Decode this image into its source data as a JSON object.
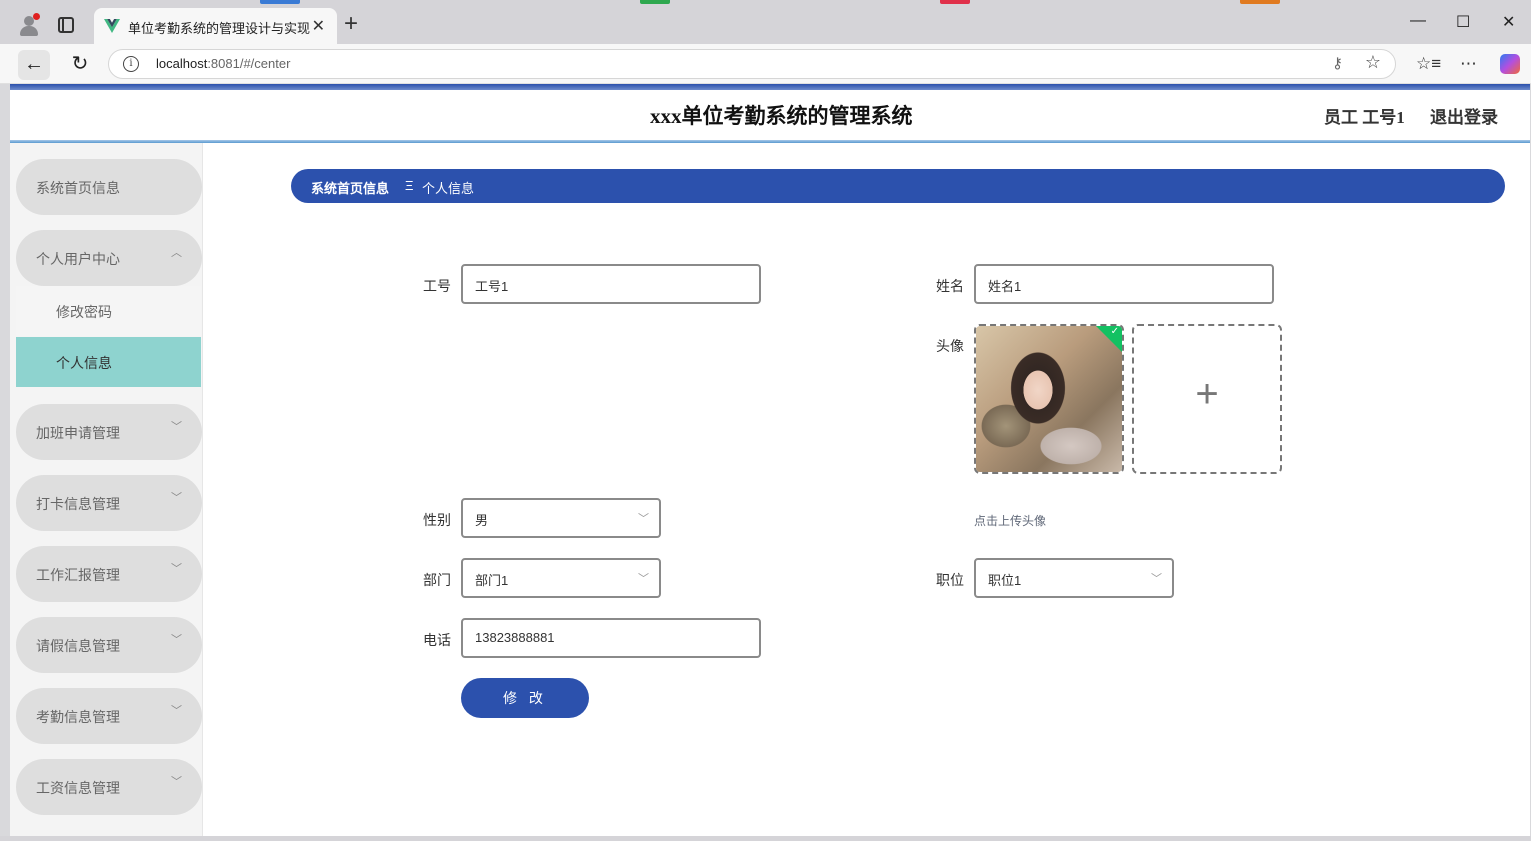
{
  "browser": {
    "tab_title": "单位考勤系统的管理设计与实现",
    "tab_close": "✕",
    "new_tab": "+",
    "url_host": "localhost",
    "url_rest": ":8081/#/center",
    "window_controls": {
      "minimize": "—",
      "maximize": "☐",
      "close": "✕"
    }
  },
  "header": {
    "system_name": "xxx单位考勤系统的管理系统",
    "user": "员工 工号1",
    "logout": "退出登录"
  },
  "sidebar": {
    "home": "系统首页信息",
    "personal_center": "个人用户中心",
    "sub_items": [
      "修改密码",
      "个人信息"
    ],
    "groups": [
      "加班申请管理",
      "打卡信息管理",
      "工作汇报管理",
      "请假信息管理",
      "考勤信息管理",
      "工资信息管理"
    ]
  },
  "breadcrumb": {
    "root": "系统首页信息",
    "separator": "Ξ",
    "current": "个人信息"
  },
  "form": {
    "labels": {
      "gonghao": "工号",
      "xingming": "姓名",
      "touxiang": "头像",
      "xingbie": "性别",
      "bumen": "部门",
      "zhiwei": "职位",
      "dianhua": "电话"
    },
    "values": {
      "gonghao": "工号1",
      "xingming": "姓名1",
      "xingbie": "男",
      "bumen": "部门1",
      "zhiwei": "职位1",
      "dianhua": "13823888881"
    },
    "upload_hint": "点击上传头像",
    "submit": "修 改"
  },
  "colors": {
    "primary": "#2c51ad",
    "active_menu": "#8ed3cf",
    "menu_pill": "#dedede",
    "success_corner": "#13c162"
  },
  "icons": [
    "profile-icon",
    "tabs-icon",
    "vue-logo-icon",
    "back-arrow-icon",
    "reload-icon",
    "info-icon",
    "key-icon",
    "star-icon",
    "favorites-icon",
    "more-icon",
    "copilot-icon",
    "chevron-up-icon",
    "chevron-down-icon",
    "plus-icon",
    "check-icon"
  ]
}
